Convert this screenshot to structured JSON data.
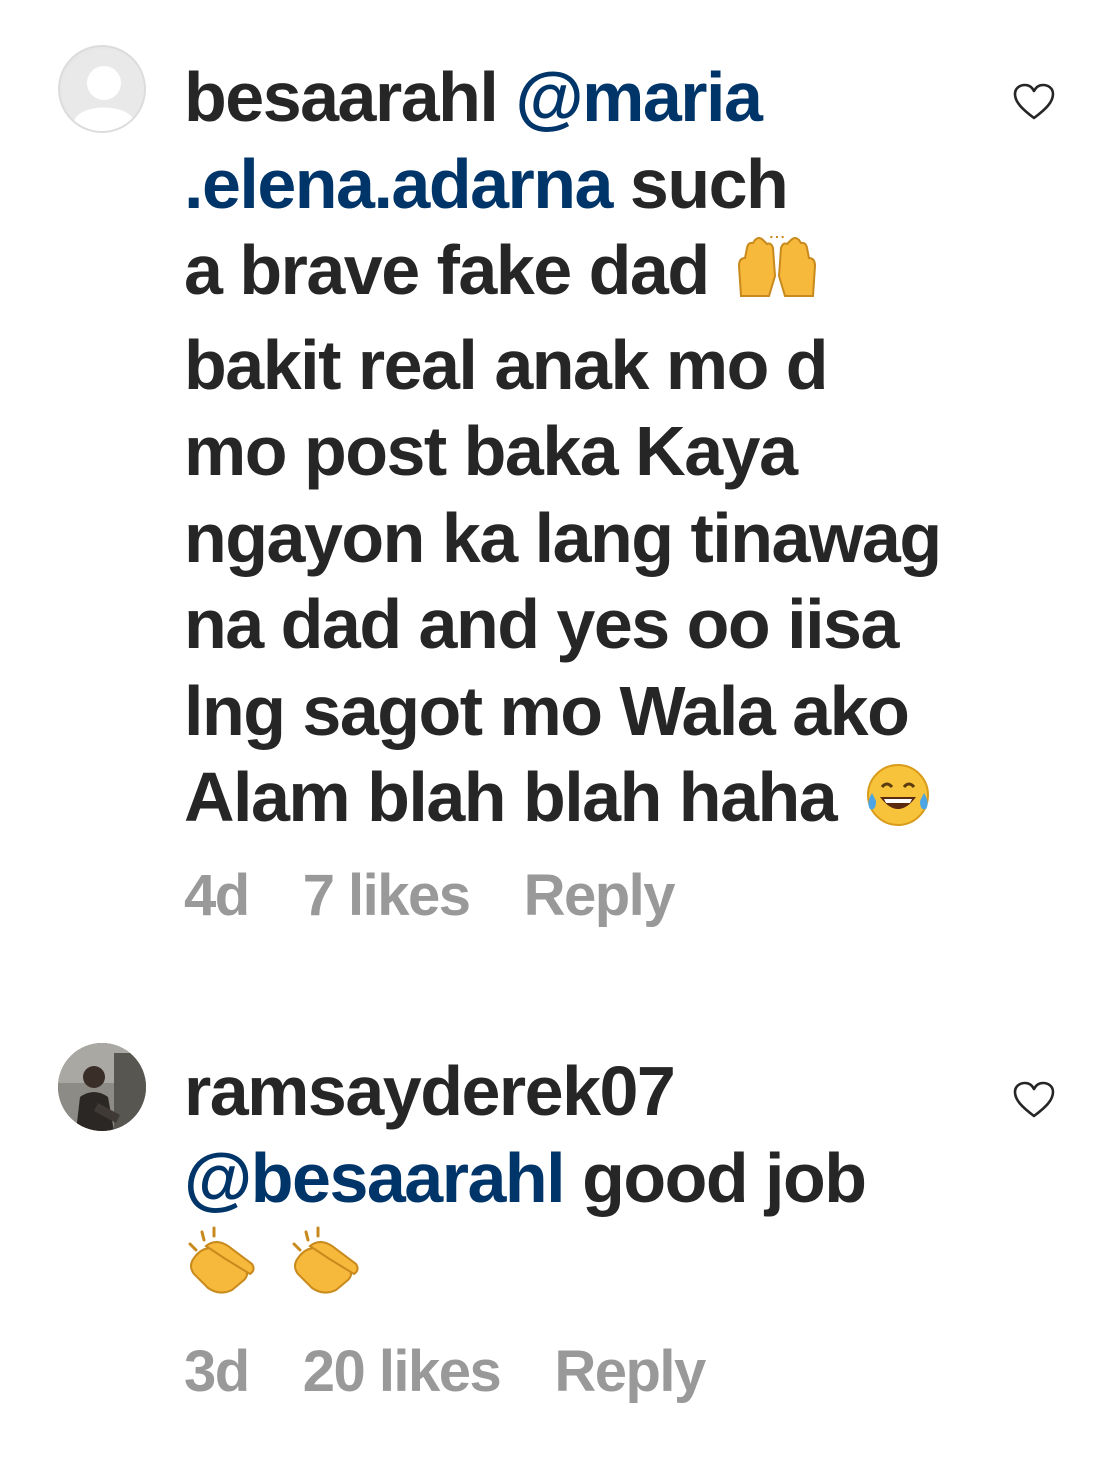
{
  "comments": [
    {
      "username": "besaarahl",
      "lines": [
        {
          "user": "besaarahl",
          "mention": "@maria"
        },
        {
          "mention": ".elena.adarna",
          "text": " such"
        },
        {
          "text": "a brave fake dad",
          "emoji": "raising-hands-emoji"
        },
        {
          "text": "bakit real anak mo d"
        },
        {
          "text": "mo post baka  Kaya"
        },
        {
          "text": "ngayon ka lang tinawag"
        },
        {
          "text": "na dad and yes oo iisa"
        },
        {
          "text": "lng sagot mo Wala ako"
        },
        {
          "text": "Alam blah blah haha",
          "emoji": "tears-of-joy-emoji"
        }
      ],
      "time": "4d",
      "likes": "7 likes",
      "reply_label": "Reply",
      "avatar": "default-avatar",
      "like_icon": "heart-outline-icon"
    },
    {
      "username": "ramsayderek07",
      "lines": [
        {
          "user": "ramsayderek07"
        },
        {
          "mention": "@besaarahl",
          "text": " good job"
        },
        {
          "emoji": "clapping-hands-emoji",
          "emoji2": "clapping-hands-emoji"
        }
      ],
      "time": "3d",
      "likes": "20 likes",
      "reply_label": "Reply",
      "avatar": "user-photo-avatar",
      "like_icon": "heart-outline-icon"
    }
  ],
  "colors": {
    "text": "#262626",
    "mention": "#003569",
    "meta": "#999999",
    "emoji_yellow": "#f6b93b"
  }
}
